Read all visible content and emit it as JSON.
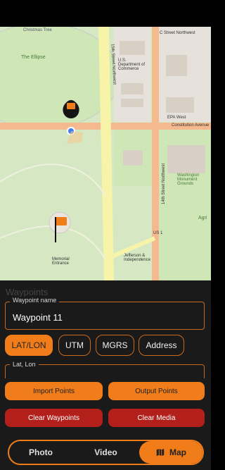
{
  "map": {
    "labels": {
      "christmas_tree": "Christmas Tree",
      "the_ellipse": "The Ellipse",
      "street_northwest": "C Street Northwest",
      "us_dept_commerce": "U.S. Department of Commerce",
      "epa_west": "EPA West",
      "constitution_ave": "Constitution Avenue",
      "fifteenth_st": "15th Street Northwest",
      "fourteenth_st": "14th Street Northwest",
      "washington_monument_grounds": "Washington Monument Grounds",
      "us1": "US 1",
      "agriculture": "Agri",
      "jefferson": "Jefferson & Independence",
      "memorial_entrance": "Memorial Entrance"
    }
  },
  "waypoints": {
    "section_title": "Waypoints",
    "name_label": "Waypoint name",
    "name_value": "Waypoint 11",
    "formats": [
      "LAT/LON",
      "UTM",
      "MGRS",
      "Address"
    ],
    "active_format": "LAT/LON",
    "latlon_label": "Lat, Lon"
  },
  "actions": {
    "import_points": "Import Points",
    "output_points": "Output Points",
    "clear_waypoints": "Clear Waypoints",
    "clear_media": "Clear Media"
  },
  "nav": {
    "photo": "Photo",
    "video": "Video",
    "map": "Map",
    "active": "Map"
  },
  "colors": {
    "accent": "#f07c1a",
    "danger": "#b31f1a",
    "map_park": "#dbe9c9",
    "road": "#f4b98e"
  }
}
